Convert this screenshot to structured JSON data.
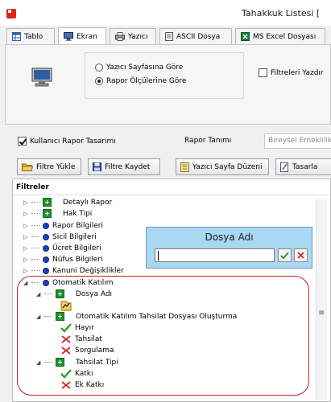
{
  "window": {
    "title": "Tahakkuk Listesi ["
  },
  "tabs": [
    {
      "label": "Tablo",
      "icon": "table-icon"
    },
    {
      "label": "Ekran",
      "icon": "monitor-icon",
      "active": true
    },
    {
      "label": "Yazıcı",
      "icon": "printer-icon"
    },
    {
      "label": "ASCII Dosya",
      "icon": "document-icon"
    },
    {
      "label": "MS Excel Dosyası",
      "icon": "excel-icon"
    }
  ],
  "print_options": {
    "radio_options": [
      {
        "label": "Yazıcı Sayfasına Göre",
        "selected": false
      },
      {
        "label": "Rapor Ölçülerine Göre",
        "selected": true
      }
    ],
    "print_filters": {
      "label": "Filtreleri Yazdır",
      "checked": false
    }
  },
  "design": {
    "user_design": {
      "label": "Kullanıcı Rapor Tasarımı",
      "checked": true
    },
    "report_def_label": "Rapor Tanımı",
    "report_def_value": "Bireysel Emeklilik"
  },
  "buttons": [
    {
      "label": "Filtre Yükle",
      "icon": "folder-open-icon"
    },
    {
      "label": "Filtre Kaydet",
      "icon": "save-icon"
    },
    {
      "label": "Yazıcı Sayfa Düzeni",
      "icon": "page-layout-icon"
    },
    {
      "label": "Tasarla",
      "icon": "design-icon"
    }
  ],
  "filters": {
    "header": "Filtreler",
    "tree": [
      {
        "label": "Detaylı Rapor",
        "type": "green"
      },
      {
        "label": "Hak Tipi",
        "type": "green"
      },
      {
        "label": "Rapor Bilgileri",
        "type": "blue"
      },
      {
        "label": "Sicil Bilgileri",
        "type": "blue"
      },
      {
        "label": "Ücret Bilgileri",
        "type": "blue"
      },
      {
        "label": "Nüfus Bilgileri",
        "type": "blue"
      },
      {
        "label": "Kanuni Değişiklikler",
        "type": "blue"
      },
      {
        "label": "Otomatik Katılım",
        "type": "blue"
      },
      {
        "label": "Dosya Adı",
        "type": "green"
      },
      {
        "label": "",
        "type": "file"
      },
      {
        "label": "Otomatik Katılım Tahsilat Dosyası Oluşturma",
        "type": "green"
      },
      {
        "label": "Hayır",
        "type": "check"
      },
      {
        "label": "Tahsilat",
        "type": "cross"
      },
      {
        "label": "Sorgulama",
        "type": "cross"
      },
      {
        "label": "Tahsilat Tipi",
        "type": "green"
      },
      {
        "label": "Katkı",
        "type": "check"
      },
      {
        "label": "Ek Katkı",
        "type": "cross"
      }
    ]
  },
  "popup": {
    "title": "Dosya Adı",
    "input_value": "",
    "ok_icon": "checkmark-icon",
    "cancel_icon": "close-icon"
  }
}
